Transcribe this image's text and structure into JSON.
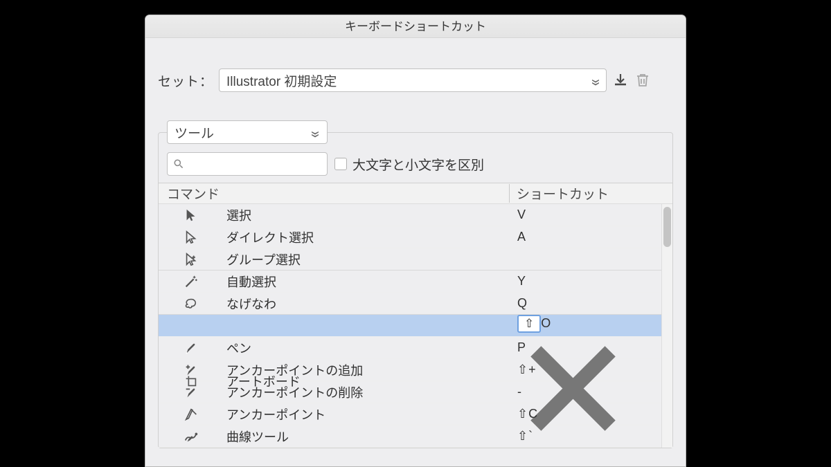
{
  "window": {
    "title": "キーボードショートカット"
  },
  "set_row": {
    "label": "セット：",
    "value": "Illustrator 初期設定"
  },
  "category_select": {
    "value": "ツール"
  },
  "search": {
    "value": ""
  },
  "case_checkbox": {
    "label": "大文字と小文字を区別",
    "checked": false
  },
  "columns": {
    "command": "コマンド",
    "shortcut": "ショートカット"
  },
  "rows": [
    {
      "icon": "selection",
      "name": "選択",
      "shortcut": "V",
      "selected": false
    },
    {
      "icon": "direct",
      "name": "ダイレクト選択",
      "shortcut": "A",
      "selected": false
    },
    {
      "icon": "group",
      "name": "グループ選択",
      "shortcut": "",
      "selected": false
    },
    {
      "icon": "wand",
      "name": "自動選択",
      "shortcut": "Y",
      "selected": false
    },
    {
      "icon": "lasso",
      "name": "なげなわ",
      "shortcut": "Q",
      "selected": false
    },
    {
      "icon": "artboard",
      "name": "アートボード",
      "shortcut": "⇧ O",
      "selected": true
    },
    {
      "icon": "pen",
      "name": "ペン",
      "shortcut": "P",
      "selected": false
    },
    {
      "icon": "addpt",
      "name": "アンカーポイントの追加",
      "shortcut": "⇧ +",
      "selected": false
    },
    {
      "icon": "delpt",
      "name": "アンカーポイントの削除",
      "shortcut": "-",
      "selected": false
    },
    {
      "icon": "anchor",
      "name": "アンカーポイント",
      "shortcut": "⇧ C",
      "selected": false
    },
    {
      "icon": "curve",
      "name": "曲線ツール",
      "shortcut": "⇧ `",
      "selected": false
    }
  ]
}
